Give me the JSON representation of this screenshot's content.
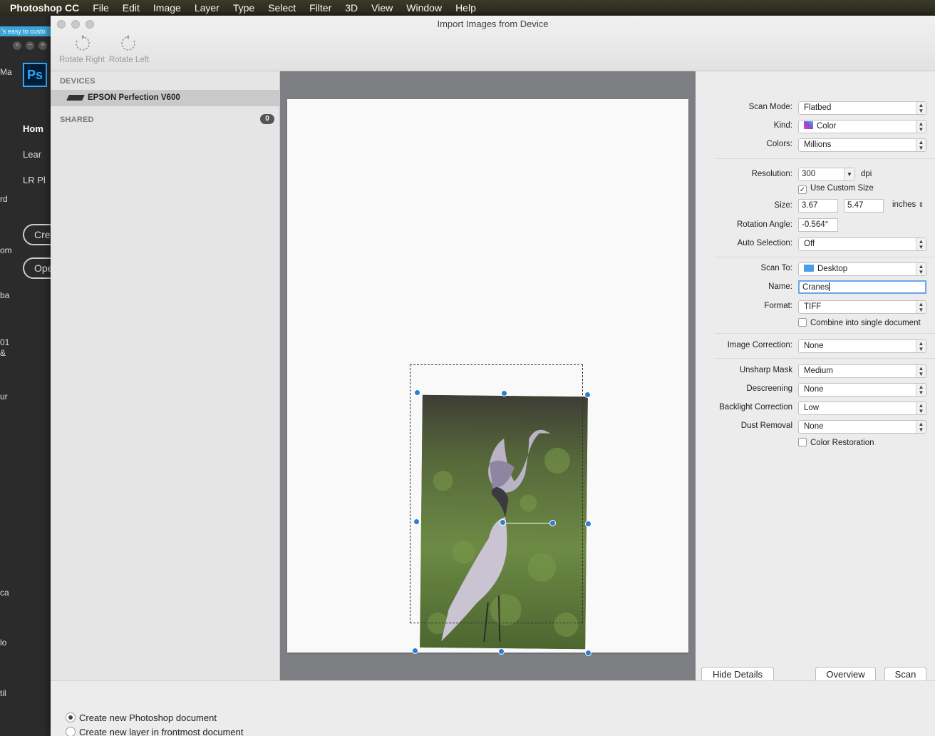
{
  "menubar": {
    "app": "Photoshop CC",
    "items": [
      "File",
      "Edit",
      "Image",
      "Layer",
      "Type",
      "Select",
      "Filter",
      "3D",
      "View",
      "Window",
      "Help"
    ]
  },
  "background_app": {
    "tooltip": "'s easy to custo",
    "logo": "Ps",
    "nav": [
      "Hom",
      "Lear",
      "LR Pl"
    ],
    "buttons": [
      "Crea",
      "Ope"
    ],
    "edge_text": [
      "Ma",
      "rd",
      "om",
      "ba",
      "01",
      "&",
      "ur",
      "ca",
      "lo",
      "til"
    ]
  },
  "window": {
    "title": "Import Images from Device",
    "toolbar": {
      "rotate_right": "Rotate Right",
      "rotate_left": "Rotate Left"
    }
  },
  "sidebar": {
    "devices_header": "DEVICES",
    "device_name": "EPSON Perfection V600",
    "shared_header": "SHARED",
    "shared_count": "0"
  },
  "settings": {
    "scan_mode": {
      "label": "Scan Mode:",
      "value": "Flatbed"
    },
    "kind": {
      "label": "Kind:",
      "value": "Color"
    },
    "colors": {
      "label": "Colors:",
      "value": "Millions"
    },
    "resolution": {
      "label": "Resolution:",
      "value": "300",
      "unit": "dpi"
    },
    "use_custom_size": {
      "label": "Use Custom Size",
      "checked": true
    },
    "size": {
      "label": "Size:",
      "width": "3.67",
      "height": "5.47",
      "unit": "inches"
    },
    "rotation_angle": {
      "label": "Rotation Angle:",
      "value": "-0.564°"
    },
    "auto_selection": {
      "label": "Auto Selection:",
      "value": "Off"
    },
    "scan_to": {
      "label": "Scan To:",
      "value": "Desktop"
    },
    "name": {
      "label": "Name:",
      "value": "Cranes"
    },
    "format": {
      "label": "Format:",
      "value": "TIFF"
    },
    "combine": {
      "label": "Combine into single document",
      "checked": false
    },
    "image_correction": {
      "label": "Image Correction:",
      "value": "None"
    },
    "unsharp_mask": {
      "label": "Unsharp Mask",
      "value": "Medium"
    },
    "descreening": {
      "label": "Descreening",
      "value": "None"
    },
    "backlight_correction": {
      "label": "Backlight Correction",
      "value": "Low"
    },
    "dust_removal": {
      "label": "Dust Removal",
      "value": "None"
    },
    "color_restoration": {
      "label": "Color Restoration",
      "checked": false
    }
  },
  "buttons": {
    "hide_details": "Hide Details",
    "overview": "Overview",
    "scan": "Scan"
  },
  "bottom": {
    "option_new_document": "Create new Photoshop document",
    "option_new_layer": "Create new layer in frontmost document",
    "selected": "option_new_document"
  },
  "colors": {
    "accent": "#2a7fd4",
    "folder": "#4a9fe8",
    "ps_blue": "#31a8ff"
  }
}
